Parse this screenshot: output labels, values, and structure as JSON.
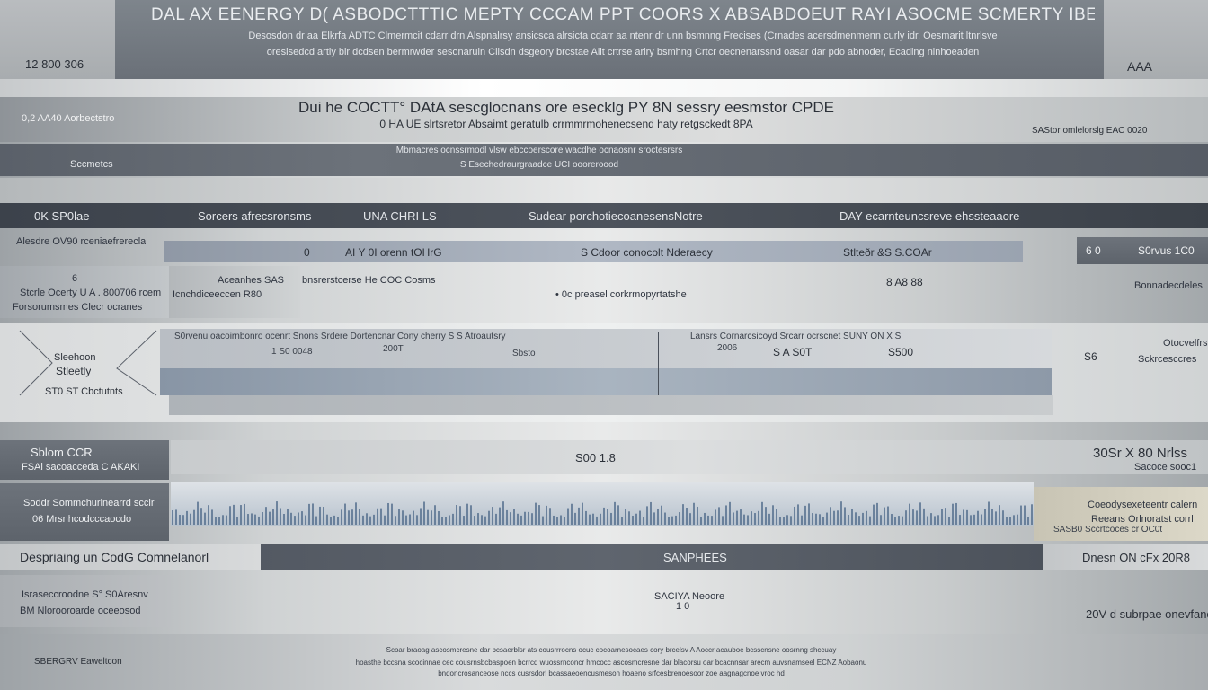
{
  "header": {
    "left_code": "12 800 306",
    "title": "DAL AX EENERGY D( ASBODCTTTIC MEPTY CCCAM PPT COORS X ABSABDOEUT RAYI ASOCME SCMERTY IBERSTTMETRY",
    "subtitle_1": "Desosdon dr aa Elkrfa ADTC Clmermcit cdarr drn Alspnalrsy ansicsca alrsicta cdarr aa ntenr dr unn bsmnng Frecises (Crnades acersdmenmenn curly idr. Oesmarit ltnrlsve",
    "subtitle_2": "oresisedcd artly blr dcdsen bermrwder sesonaruin Clisdn dsgeory brcstae Allt crtrse ariry bsmhng Crtcr oecnenarssnd oasar dar pdo abnoder, Ecading ninhoeaden",
    "right_label": "AAA"
  },
  "section_a": {
    "left_label": "0,2 AA40 Aorbectstro",
    "center_title": "Dui he COCTT° DAtA sescglocnans ore esecklg PY 8N sessry eesmstor CPDE",
    "center_sub": "0 HA UE slrtsretor Absaimt geratulb crrmmrmohenecsend haty retgsckedt 8PA",
    "right_label": "SAStor omlelorslg EAC 0020"
  },
  "section_b": {
    "left_label": "Sccmetcs",
    "line_1": "Mbmacres ocnssrmodl vlsw ebccoerscore wacdhe ocnaosnr sroctesrsrs",
    "line_2": "S Esechedraurgraadce UCI oooreroood"
  },
  "columns": [
    "0K SP0lae",
    "Sorcers afrecsronsms",
    "UNA CHRI LS",
    "Sudear porchotiecoanesensNotre",
    "DAY ecarnteuncsreve ehssteaaore"
  ],
  "row1": {
    "left": "Alesdre OV90 rceniaefrerecla",
    "c1": "0",
    "c2": "AI Y 0I orenn tOHrG",
    "c3": "S Cdoor conocolt Nderaecy",
    "c4": "Stlteðr &S S.COAr",
    "right_code": "6 0",
    "right_label": "S0rvus 1C0"
  },
  "row2": {
    "num": "6",
    "left_1": "Stcrle Ocerty U A . 800706 rcem",
    "left_2": "Forsorumsmes Clecr ocranes",
    "mid_1": "Aceanhes SAS",
    "mid_2": "Icnchdiceeccen R80",
    "c_1": "bnsrerstcerse He COC Cosms",
    "c_2": "• 0c preasel corkrmopyrtatshe",
    "right_code": "8 A8 88",
    "far_right": "Bonnadecdeles"
  },
  "row3": {
    "left_1": "Sleehoon",
    "left_2": "Stleetly",
    "left_3": "ST0 ST Cbctutnts",
    "line_a": "S0rvenu oacoirnbonro ocenrt Snons Srdere Dortencnar Cony cherry S S Atroautsry",
    "line_b": "Lansrs Cornarcsicoyd Srcarr ocrscnet SUNY ON X S",
    "n1": "1 S0 0048",
    "n2": "200T",
    "n3": "Sbsto",
    "n4": "2006",
    "n5": "S A S0T",
    "n6": "S500",
    "right_code": "S6",
    "right_1": "Otocvelfrs",
    "right_2": "Sckrcesccres"
  },
  "row4": {
    "left_1": "Sblom CCR",
    "left_2": "FSAl sacoacceda C AKAKI",
    "center": "S00 1.8",
    "right_1": "30Sr X 80 Nrlss",
    "right_2": "Sacoce sooc1"
  },
  "row5": {
    "left_1": "Soddr Sommchurinearrd scclr",
    "left_2": "06 Mrsnhcodcccaocdo",
    "right_1": "Coeodysexeteentr calern",
    "right_2": "Reeans Orlnoratst corrl",
    "right_3": "SASB0 Sccrtcoces cr OC0t"
  },
  "row6": {
    "left": "Despriaing un CodG Comnelanorl",
    "center": "SANPHEES",
    "right": "Dnesn ON cFx 20R8"
  },
  "row7": {
    "left_1": "Israseccroodne S° S0Aresnv",
    "left_2": "BM Nlorooroarde oceeosod",
    "center_1": "SACIYA Neoore",
    "center_2": "1 0",
    "right": "20V d subrpae onevfanoe"
  },
  "footer": {
    "left": "SBERGRV Eaweltcon",
    "line_1": "Scoar braoag ascosmcresne dar bcsaerblsr ats cousrrrocns ocuc cocoarnesocaes cory brcelsv A Aoccr acauboe bcsscnsne oosrnng shccuay",
    "line_2": "hoasthe bccsna scocinnae cec cousrnsbcbaspoen bcrrcd wuossrnconcr hmcocc ascosmcresne dar blacorsu oar bcacnnsar arecm auvsnamseel ECNZ Aobaonu",
    "line_3": "bndoncrosanceose nccs cusrsdorl bcassaeoencusmeson hoaeno srfcesbrenoesoor zoe aagnagcnoe vroc hd"
  },
  "colors": {
    "header_bg": "#6a7078",
    "dark_band": "#3c424b",
    "bar_blue": "#8f98a5",
    "wave_blue": "#4f6a8a"
  }
}
